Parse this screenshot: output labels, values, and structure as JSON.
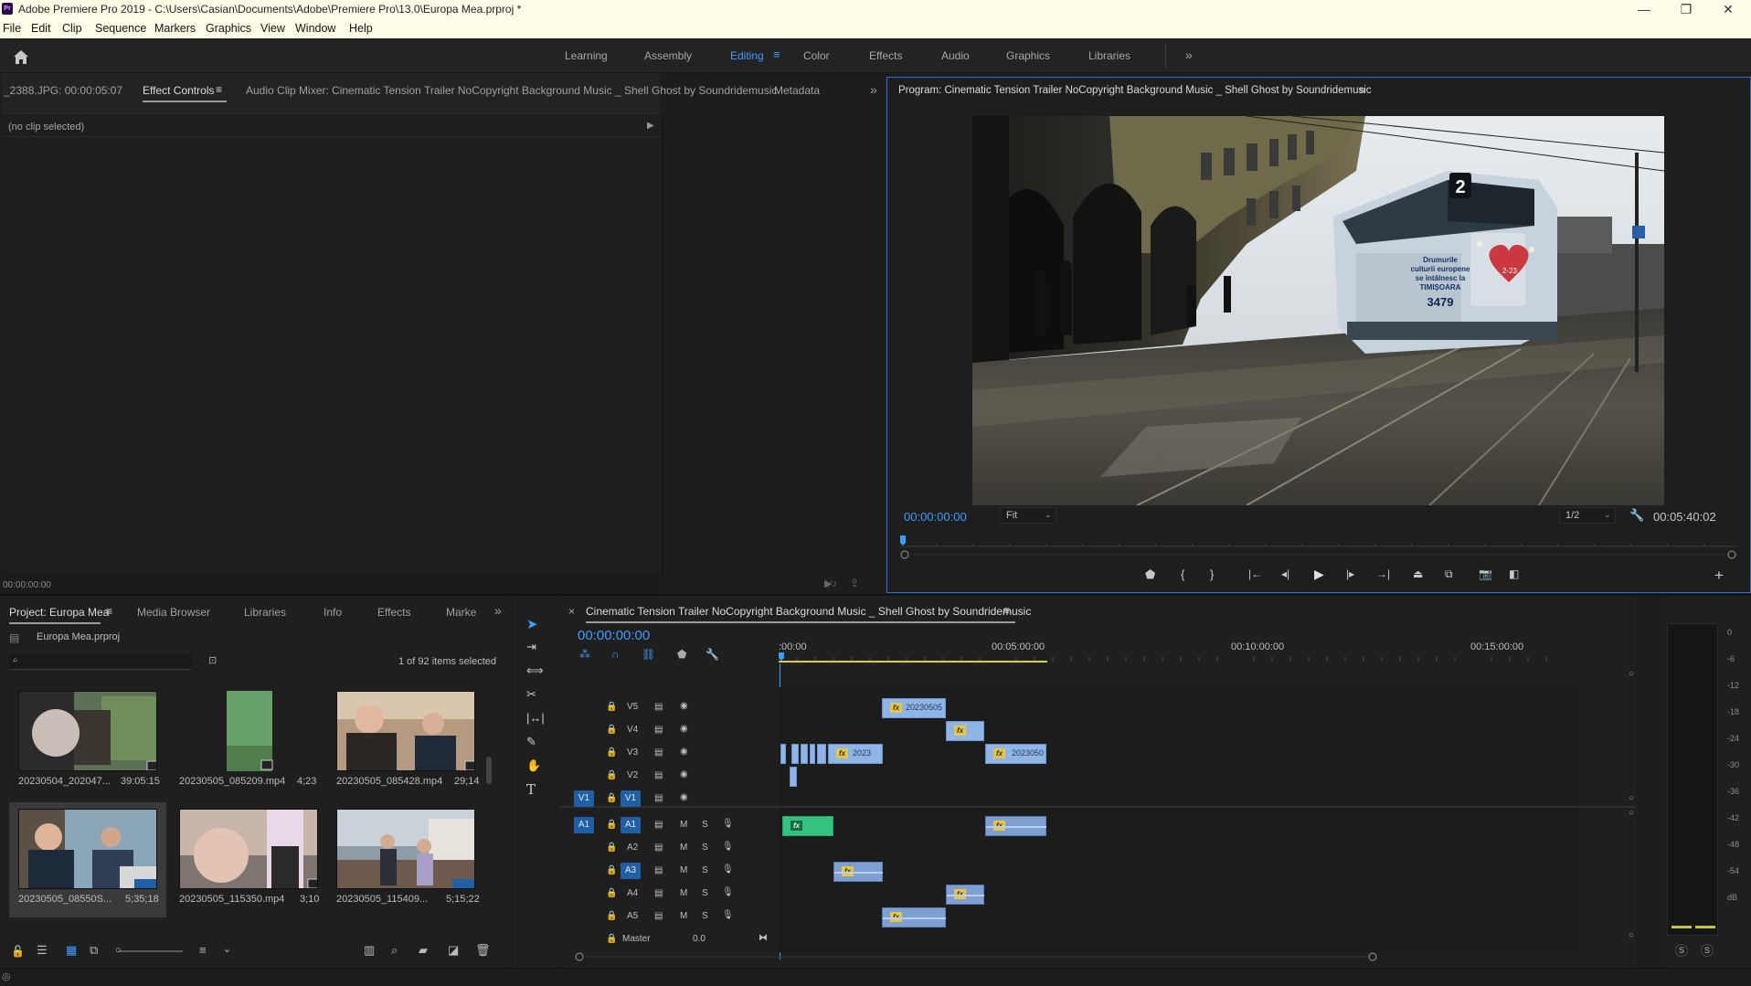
{
  "window": {
    "app_icon": "Pr",
    "title": "Adobe Premiere Pro 2019 - C:\\Users\\Casian\\Documents\\Adobe\\Premiere Pro\\13.0\\Europa Mea.prproj *",
    "minimize": "—",
    "maximize": "❐",
    "close": "✕"
  },
  "menu": [
    "File",
    "Edit",
    "Clip",
    "Sequence",
    "Markers",
    "Graphics",
    "View",
    "Window",
    "Help"
  ],
  "workspaces": {
    "items": [
      "Learning",
      "Assembly",
      "Editing",
      "Color",
      "Effects",
      "Audio",
      "Graphics",
      "Libraries"
    ],
    "active": "Editing",
    "more": "»"
  },
  "source_panel": {
    "tabs": [
      "_2388.JPG: 00:00:05:07",
      "Effect Controls",
      "Audio Clip Mixer: Cinematic Tension Trailer NoCopyright Background Music _ Shell Ghost by Soundridemusic",
      "Metadata"
    ],
    "active_tab": "Effect Controls",
    "more": "»",
    "no_clip": "(no clip selected)",
    "timecode": "00:00:00:00"
  },
  "program": {
    "title": "Program: Cinematic Tension Trailer NoCopyright Background Music _ Shell Ghost by Soundridemusic",
    "timecode": "00:00:00:00",
    "fit": "Fit",
    "resolution": "1/2",
    "duration": "00:05:40:02",
    "add": "+",
    "tram_number": "2",
    "tram_text_lines": [
      "Drumurile",
      "culturii europene",
      "se întâlnesc la",
      "TIMIȘOARA"
    ],
    "tram_id": "3479",
    "tram_badge": "2-23"
  },
  "project": {
    "tabs": [
      "Project: Europa Mea",
      "Media Browser",
      "Libraries",
      "Info",
      "Effects",
      "Marke"
    ],
    "active_tab": "Project: Europa Mea",
    "more": "»",
    "file": "Europa Mea.prproj",
    "search_placeholder": "",
    "selection": "1 of 92 items selected",
    "items": [
      {
        "name": "20230504_202047...",
        "duration": "39:05:15"
      },
      {
        "name": "20230505_085209.mp4",
        "duration": "4;23"
      },
      {
        "name": "20230505_085428.mp4",
        "duration": "29;14"
      },
      {
        "name": "20230505_08550S...",
        "duration": "5;35;18"
      },
      {
        "name": "20230505_115350.mp4",
        "duration": "3;10"
      },
      {
        "name": "20230505_115409...",
        "duration": "5;15;22"
      }
    ]
  },
  "timeline": {
    "close": "×",
    "sequence": "Cinematic Tension Trailer NoCopyright Background Music _ Shell Ghost by Soundridemusic",
    "timecode": "00:00:00:00",
    "ruler": [
      ":00:00",
      "00:05:00:00",
      "00:10:00:00",
      "00:15:00:00"
    ],
    "video_tracks": [
      "V5",
      "V4",
      "V3",
      "V2",
      "V1"
    ],
    "audio_tracks": [
      "A1",
      "A2",
      "A3",
      "A4",
      "A5"
    ],
    "source_v": "V1",
    "source_a": "A1",
    "mute": "M",
    "solo": "S",
    "master_label": "Master",
    "master_value": "0.0",
    "clip_labels": {
      "v5": "20230505",
      "v3a": "2023",
      "v3b": "2023050"
    },
    "fx": "fx"
  },
  "meters": {
    "ticks": [
      "0",
      "-6",
      "-12",
      "-18",
      "-24",
      "-30",
      "-36",
      "-42",
      "-48",
      "-54",
      "dB"
    ],
    "solo_left": "S",
    "solo_right": "S"
  },
  "colors": {
    "accent": "#3f9cff",
    "video_clip": "#8fb4e6",
    "audio_clip": "#7e9fd2",
    "audio_clip_green": "#33c27f",
    "fx_badge": "#e6c648",
    "playhead": "#3f9cff",
    "work_area": "#d8d040"
  }
}
